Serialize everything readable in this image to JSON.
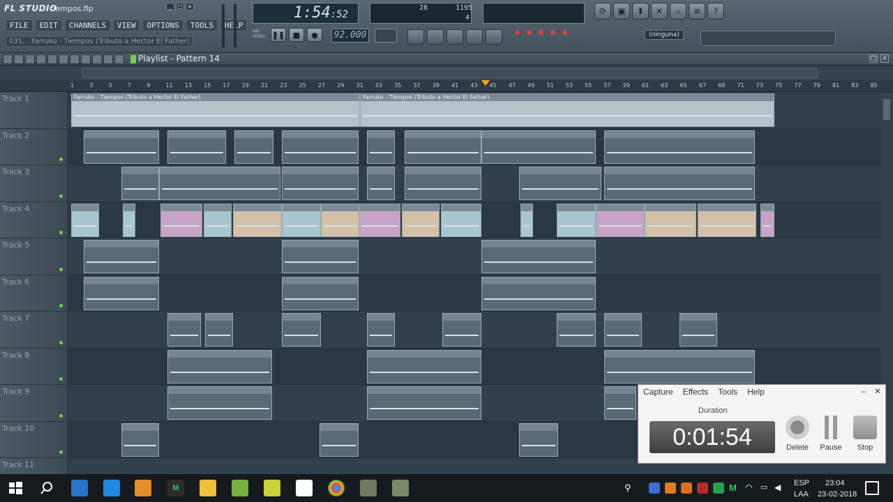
{
  "app": {
    "logo": "FL STUDIO",
    "file_name": "tiempos.flp",
    "hint_bar": "031... Farruko - Tiempos (Tributo a Hector El Father)",
    "menu": [
      "FILE",
      "EDIT",
      "CHANNELS",
      "VIEW",
      "OPTIONS",
      "TOOLS",
      "HELP"
    ],
    "time_main": "1:54",
    "time_sub": ":52",
    "tempo": "92.000",
    "monitor_cpu": "28",
    "monitor_mem": "1195",
    "monitor_poly": "4",
    "midi_input": "(ninguna)",
    "mode_labels": [
      "PAT",
      "SONG"
    ]
  },
  "playlist": {
    "title": "Playlist - Pattern 14",
    "ruler": [
      "1",
      "3",
      "5",
      "7",
      "9",
      "11",
      "13",
      "15",
      "17",
      "19",
      "21",
      "23",
      "25",
      "27",
      "29",
      "31",
      "33",
      "35",
      "37",
      "39",
      "41",
      "43",
      "45",
      "47",
      "49",
      "51",
      "53",
      "55",
      "57",
      "59",
      "61",
      "63",
      "65",
      "67",
      "69",
      "71",
      "73",
      "75",
      "77",
      "79",
      "81",
      "83",
      "85"
    ],
    "tracks": [
      "Track 1",
      "Track 2",
      "Track 3",
      "Track 4",
      "Track 5",
      "Track 6",
      "Track 7",
      "Track 8",
      "Track 9",
      "Track 10",
      "Track 11"
    ],
    "audio_clip_label": "Farruko - Tiempos (Tributo a Hector El Father)"
  },
  "recorder": {
    "menu": [
      "Capture",
      "Effects",
      "Tools",
      "Help"
    ],
    "duration_label": "Duration",
    "timer": "0:01:54",
    "buttons": [
      "Delete",
      "Pause",
      "Stop"
    ]
  },
  "taskbar": {
    "lang_top": "ESP",
    "lang_bottom": "LAA",
    "time": "23:04",
    "date": "23-02-2018"
  }
}
